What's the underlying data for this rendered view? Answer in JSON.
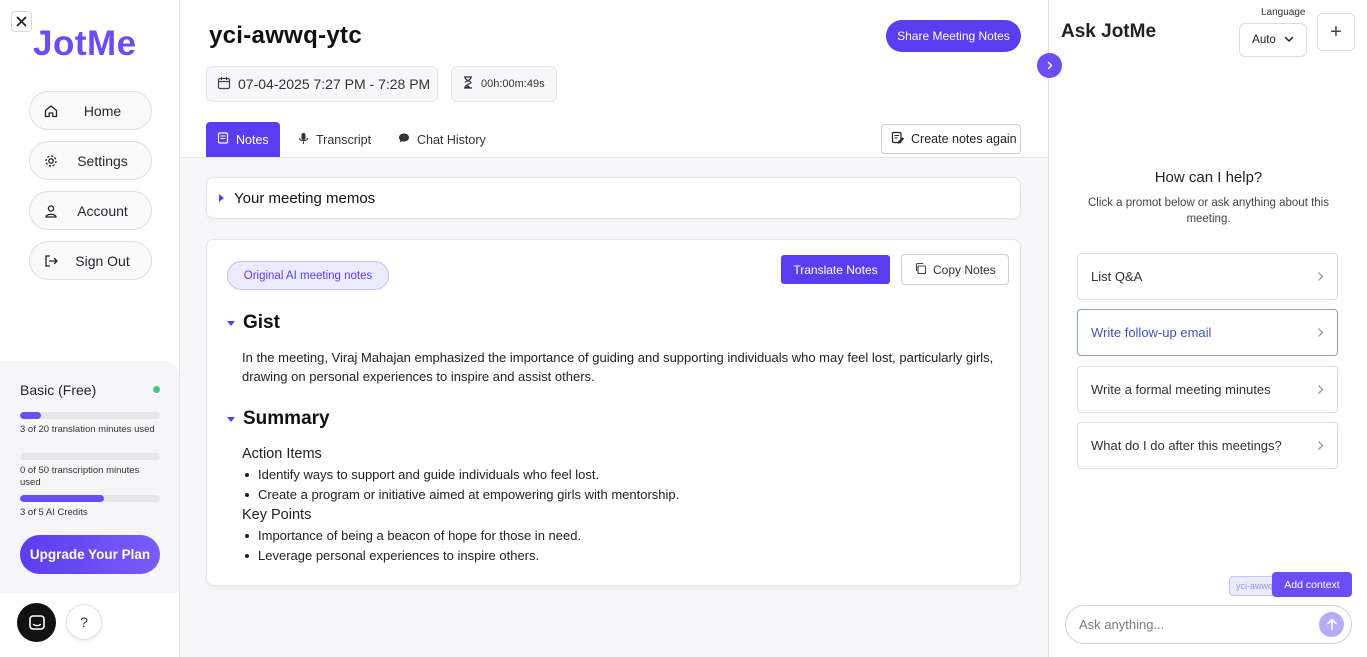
{
  "app": {
    "logo": "JotMe"
  },
  "sidebar": {
    "items": [
      {
        "label": "Home",
        "icon": "home-icon"
      },
      {
        "label": "Settings",
        "icon": "gear-icon"
      },
      {
        "label": "Account",
        "icon": "user-icon"
      },
      {
        "label": "Sign Out",
        "icon": "sign-out-icon"
      }
    ],
    "plan": {
      "title": "Basic (Free)",
      "status_color": "#4cc47c",
      "usage": [
        {
          "label": "3 of 20 translation minutes used",
          "fraction": 0.15
        },
        {
          "label": "0 of 50 transcription minutes used",
          "fraction": 0
        },
        {
          "label": "3 of 5 AI Credits",
          "fraction": 0.6
        }
      ],
      "upgrade_label": "Upgrade Your Plan"
    },
    "help_label": "?"
  },
  "meeting": {
    "title": "yci-awwq-ytc",
    "share_label": "Share Meeting Notes",
    "datetime": "07-04-2025 7:27 PM - 7:28 PM",
    "duration": "00h:00m:49s",
    "tabs": [
      {
        "label": "Notes",
        "icon": "notes-icon",
        "active": true
      },
      {
        "label": "Transcript",
        "icon": "microphone-icon",
        "active": false
      },
      {
        "label": "Chat History",
        "icon": "chat-icon",
        "active": false
      }
    ],
    "recreate_label": "Create notes again",
    "memos_label": "Your meeting memos"
  },
  "notes": {
    "badge": "Original AI meeting notes",
    "translate_label": "Translate Notes",
    "copy_label": "Copy Notes",
    "gist": {
      "heading": "Gist",
      "text": "In the meeting, Viraj Mahajan emphasized the importance of guiding and supporting individuals who may feel lost, particularly girls, drawing on personal experiences to inspire and assist others."
    },
    "summary": {
      "heading": "Summary",
      "action_heading": "Action Items",
      "actions": [
        "Identify ways to support and guide individuals who feel lost.",
        "Create a program or initiative aimed at empowering girls with mentorship."
      ],
      "points_heading": "Key Points",
      "points": [
        "Importance of being a beacon of hope for those in need.",
        "Leverage personal experiences to inspire others."
      ]
    }
  },
  "ask": {
    "title": "Ask JotMe",
    "language_label": "Language",
    "language_value": "Auto",
    "plus_label": "+",
    "help_title": "How can I help?",
    "help_sub": "Click a promot below or ask anything about this meeting.",
    "prompts": [
      "List Q&A",
      "Write follow-up email",
      "Write a formal meeting minutes",
      "What do I do after this meetings?"
    ],
    "context_chip": "yci-awwq-ytc",
    "add_context_label": "Add context",
    "input_placeholder": "Ask anything..."
  },
  "colors": {
    "accent": "#5b3df0",
    "brand": "#6b4cf6"
  }
}
